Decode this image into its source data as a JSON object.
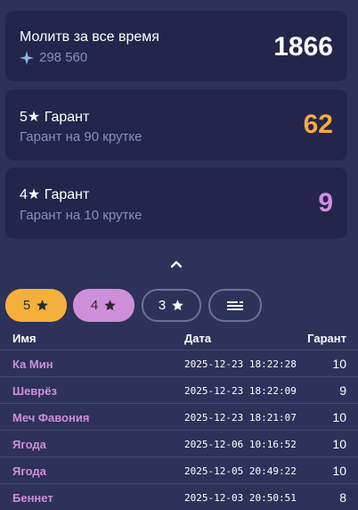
{
  "cards": [
    {
      "title": "Молитв за все время",
      "sub_icon": "sparkle-icon",
      "sub": "298 560",
      "value": "1866",
      "color": "#ffffff"
    },
    {
      "title": "5★ Гарант",
      "sub": "Гарант на 90 крутке",
      "value": "62",
      "color": "#f5a742"
    },
    {
      "title": "4★ Гарант",
      "sub": "Гарант на 10 крутке",
      "value": "9",
      "color": "#d08fe0"
    }
  ],
  "filters": [
    {
      "label": "5",
      "active": true,
      "color": "#f5b03b"
    },
    {
      "label": "4",
      "active": true,
      "color": "#cf8ed9"
    },
    {
      "label": "3",
      "active": false
    },
    {
      "icon": "list-icon"
    }
  ],
  "table": {
    "headers": [
      "Имя",
      "Дата",
      "Гарант"
    ],
    "rows": [
      {
        "name": "Ка Мин",
        "date": "2025-12-23 18:22:28",
        "pity": "10"
      },
      {
        "name": "Шеврёз",
        "date": "2025-12-23 18:22:09",
        "pity": "9"
      },
      {
        "name": "Меч Фавония",
        "date": "2025-12-23 18:21:07",
        "pity": "10"
      },
      {
        "name": "Ягода",
        "date": "2025-12-06 10:16:52",
        "pity": "10"
      },
      {
        "name": "Ягода",
        "date": "2025-12-05 20:49:22",
        "pity": "10"
      },
      {
        "name": "Беннет",
        "date": "2025-12-03 20:50:51",
        "pity": "8"
      }
    ]
  }
}
